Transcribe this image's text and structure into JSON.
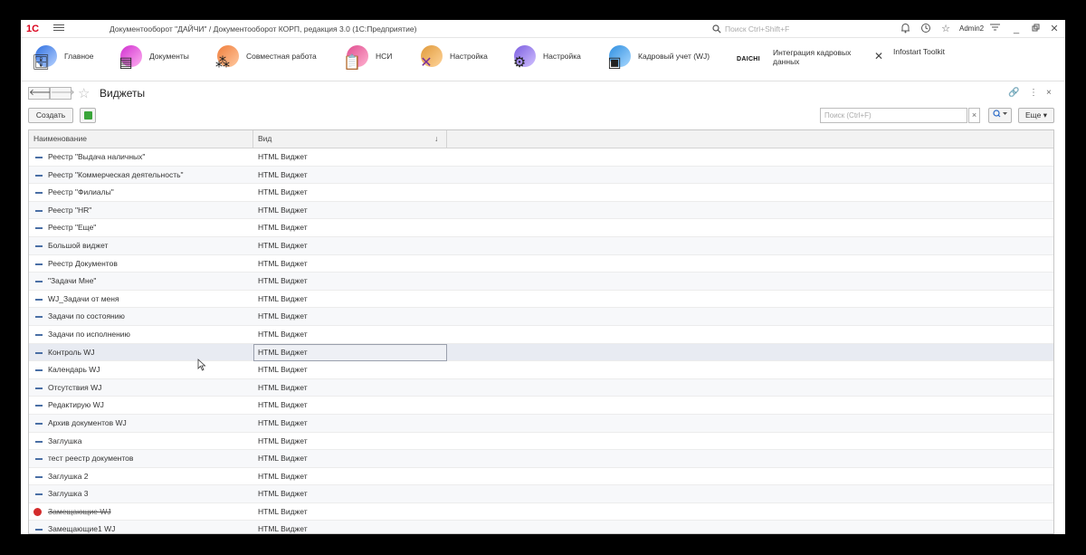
{
  "titlebar": {
    "logo": "1С",
    "title": "Документооборот \"ДАЙЧИ\" / Документооборот КОРП, редакция 3.0  (1С:Предприятие)",
    "search_placeholder": "Поиск Ctrl+Shift+F",
    "user": "Admin2"
  },
  "sections": [
    {
      "label": "Главное",
      "icon": "home-register-icon",
      "color": "#3b7be0"
    },
    {
      "label": "Документы",
      "icon": "documents-icon",
      "color": "#e03bd0"
    },
    {
      "label": "Совместная работа",
      "icon": "team-icon",
      "color": "#f08c3c"
    },
    {
      "label": "НСИ",
      "icon": "reference-book-icon",
      "color": "#e05b9c"
    },
    {
      "label": "Настройка",
      "icon": "tools-icon",
      "color": "#e0a03b"
    },
    {
      "label": "Настройка",
      "icon": "gear-icon",
      "color": "#8a6be0"
    },
    {
      "label": "Кадровый учет (WJ)",
      "icon": "personnel-icon",
      "color": "#3b9be0"
    },
    {
      "label": "Интеграция кадровых данных",
      "icon": "daichi-logo",
      "logo_text": "DAICHI"
    },
    {
      "label": "Infostart Toolkit",
      "icon": "toolkit-icon"
    }
  ],
  "form": {
    "title": "Виджеты",
    "create_label": "Создать",
    "search_placeholder": "Поиск (Ctrl+F)",
    "search_clear": "×",
    "more_label": "Еще"
  },
  "table": {
    "columns": [
      "Наименование",
      "Вид"
    ],
    "sort_indicator": "↓",
    "rows": [
      {
        "name": "Реестр \"Выдача наличных\"",
        "kind": "HTML Виджет"
      },
      {
        "name": "Реестр \"Коммерческая деятельность\"",
        "kind": "HTML Виджет"
      },
      {
        "name": "Реестр \"Филиалы\"",
        "kind": "HTML Виджет"
      },
      {
        "name": "Реестр \"HR\"",
        "kind": "HTML Виджет"
      },
      {
        "name": "Реестр \"Еще\"",
        "kind": "HTML Виджет"
      },
      {
        "name": "Большой виджет",
        "kind": "HTML Виджет"
      },
      {
        "name": "Реестр Документов",
        "kind": "HTML Виджет"
      },
      {
        "name": "\"Задачи Мне\"",
        "kind": "HTML Виджет"
      },
      {
        "name": "WJ_Задачи от меня",
        "kind": "HTML Виджет"
      },
      {
        "name": "Задачи по состоянию",
        "kind": "HTML Виджет"
      },
      {
        "name": "Задачи по исполнению",
        "kind": "HTML Виджет"
      },
      {
        "name": "Контроль WJ",
        "kind": "HTML Виджет",
        "selected": true
      },
      {
        "name": "Календарь WJ",
        "kind": "HTML Виджет"
      },
      {
        "name": "Отсутствия WJ",
        "kind": "HTML Виджет"
      },
      {
        "name": "Редактирую WJ",
        "kind": "HTML Виджет"
      },
      {
        "name": "Архив документов WJ",
        "kind": "HTML Виджет"
      },
      {
        "name": "Заглушка",
        "kind": "HTML Виджет"
      },
      {
        "name": "тест реестр документов",
        "kind": "HTML Виджет"
      },
      {
        "name": "Заглушка 2",
        "kind": "HTML Виджет"
      },
      {
        "name": "Заглушка 3",
        "kind": "HTML Виджет"
      },
      {
        "name": "Замещающие WJ",
        "kind": "HTML Виджет",
        "deleted": true
      },
      {
        "name": "Замещающие1 WJ",
        "kind": "HTML Виджет"
      }
    ]
  }
}
